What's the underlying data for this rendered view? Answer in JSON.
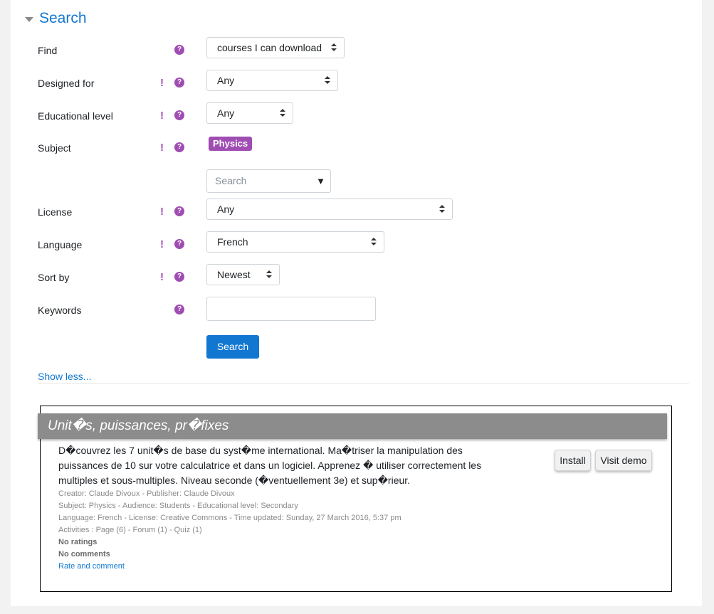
{
  "section": {
    "title": "Search"
  },
  "form": {
    "find": {
      "label": "Find",
      "value": "courses I can download"
    },
    "designed_for": {
      "label": "Designed for",
      "value": "Any"
    },
    "edu_level": {
      "label": "Educational level",
      "value": "Any"
    },
    "subject": {
      "label": "Subject",
      "tag": "Physics",
      "search_placeholder": "Search"
    },
    "license": {
      "label": "License",
      "value": "Any"
    },
    "language": {
      "label": "Language",
      "value": "French"
    },
    "sort_by": {
      "label": "Sort by",
      "value": "Newest"
    },
    "keywords": {
      "label": "Keywords",
      "value": ""
    },
    "search_button": "Search",
    "show_less": "Show less...",
    "help_glyph": "?",
    "required_glyph": "!"
  },
  "result": {
    "title": "Unit�s, puissances, pr�fixes",
    "description": "D�couvrez les 7 unit�s de base du syst�me international. Ma�triser la manipulation des puissances de 10 sur votre calculatrice et dans un logiciel. Apprenez � utiliser correctement les multiples et sous-multiples. Niveau seconde (�ventuellement 3e) et sup�rieur.",
    "creator_line": "Creator: Claude Divoux - Publisher: Claude Divoux",
    "subject_line": "Subject: Physics - Audience: Students - Educational level: Secondary",
    "language_line": "Language: French - License: Creative Commons - Time updated: Sunday, 27 March 2016, 5:37 pm",
    "activities_line": "Activities : Page (6) - Forum (1) - Quiz (1)",
    "ratings": "No ratings",
    "comments": "No comments",
    "rate_link": "Rate and comment",
    "install_button": "Install",
    "demo_button": "Visit demo"
  },
  "colors": {
    "accent": "#1177d1",
    "help": "#a04db3",
    "result_title_bg": "#8c8c8c"
  }
}
